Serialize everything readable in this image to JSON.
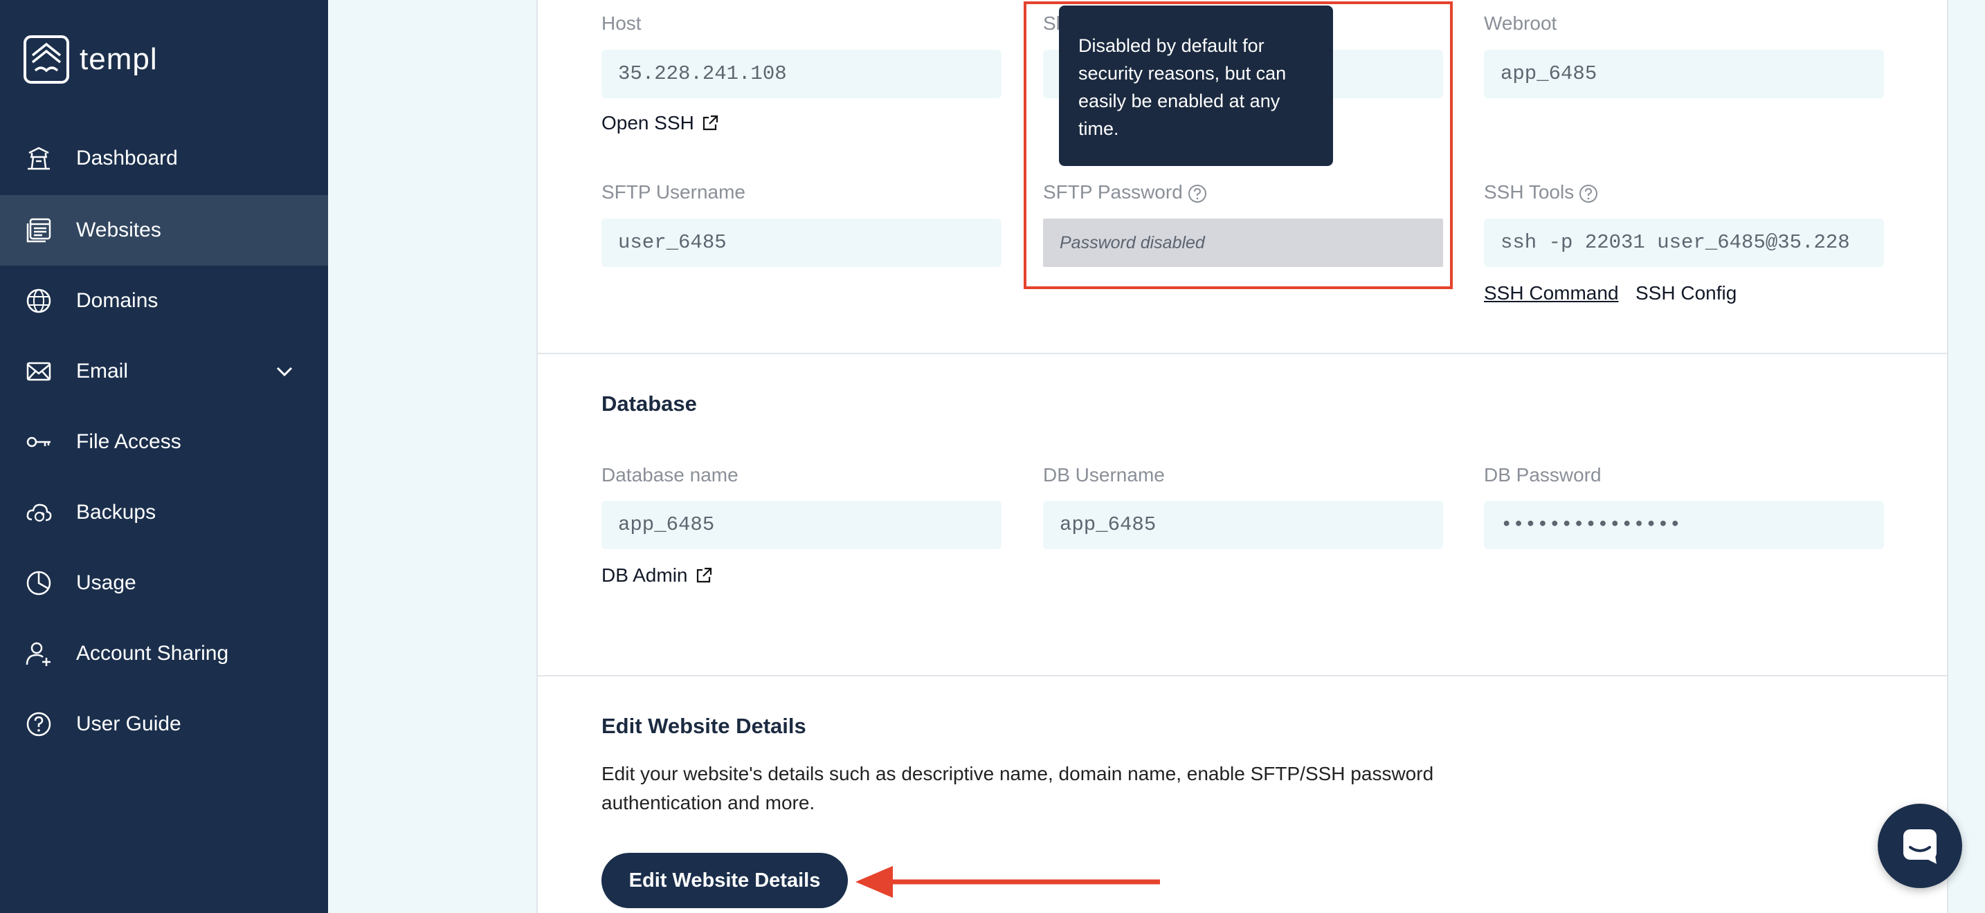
{
  "app": {
    "brand": "templ"
  },
  "sidebar": {
    "items": [
      {
        "label": "Dashboard",
        "icon": "temple-icon"
      },
      {
        "label": "Websites",
        "icon": "websites-icon",
        "active": true
      },
      {
        "label": "Domains",
        "icon": "globe-www-icon"
      },
      {
        "label": "Email",
        "icon": "envelope-icon",
        "has_dropdown": true
      },
      {
        "label": "File Access",
        "icon": "key-icon"
      },
      {
        "label": "Backups",
        "icon": "cloud-sync-icon"
      },
      {
        "label": "Usage",
        "icon": "pie-chart-icon"
      },
      {
        "label": "Account Sharing",
        "icon": "user-add-icon"
      },
      {
        "label": "User Guide",
        "icon": "help-circle-icon"
      }
    ]
  },
  "access": {
    "host_label": "Host",
    "host_value": "35.228.241.108",
    "open_ssh": "Open SSH",
    "ssh_port_label_partial": "Sl",
    "webroot_label": "Webroot",
    "webroot_value": "app_6485",
    "sftp_username_label": "SFTP Username",
    "sftp_username_value": "user_6485",
    "sftp_password_label": "SFTP Password",
    "sftp_password_value": "Password disabled",
    "ssh_tools_label": "SSH Tools",
    "ssh_tools_value": "ssh -p 22031 user_6485@35.228",
    "ssh_command": "SSH Command",
    "ssh_config": "SSH Config"
  },
  "tooltip": {
    "text": "Disabled by default for security reasons, but can easily be enabled at any time."
  },
  "database": {
    "title": "Database",
    "name_label": "Database name",
    "name_value": "app_6485",
    "user_label": "DB Username",
    "user_value": "app_6485",
    "password_label": "DB Password",
    "password_value": "•••••••••••••••",
    "db_admin": "DB Admin"
  },
  "edit": {
    "title": "Edit Website Details",
    "description": "Edit your website's details such as descriptive name, domain name, enable SFTP/SSH password authentication and more.",
    "button_label": "Edit Website Details"
  },
  "colors": {
    "sidebar_bg": "#1b2f4c",
    "active_bg": "#32465f",
    "highlight": "#e5432d",
    "field_bg": "#eef8fa"
  }
}
